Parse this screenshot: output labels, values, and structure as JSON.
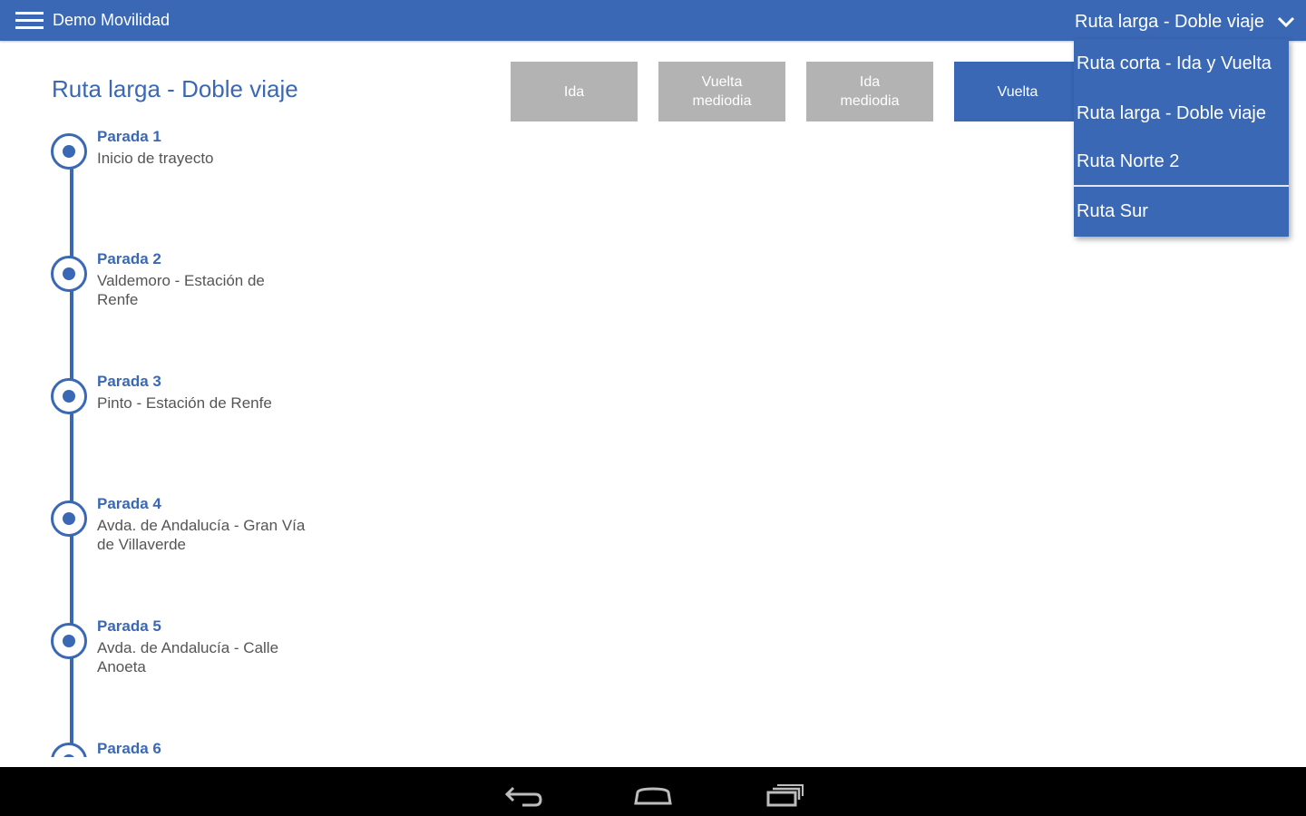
{
  "topbar": {
    "app_title": "Demo Movilidad",
    "selected_route": "Ruta larga - Doble viaje"
  },
  "page": {
    "route_title": "Ruta larga - Doble viaje"
  },
  "tabs": [
    {
      "label": "Ida",
      "active": false
    },
    {
      "label": "Vuelta mediodia",
      "active": false
    },
    {
      "label": "Ida mediodia",
      "active": false
    },
    {
      "label": "Vuelta",
      "active": true
    }
  ],
  "stops": [
    {
      "name": "Parada 1",
      "description": "Inicio de trayecto"
    },
    {
      "name": "Parada 2",
      "description": "Valdemoro - Estación de Renfe"
    },
    {
      "name": "Parada 3",
      "description": "Pinto - Estación de Renfe"
    },
    {
      "name": "Parada 4",
      "description": "Avda. de Andalucía - Gran Vía de Villaverde"
    },
    {
      "name": "Parada 5",
      "description": "Avda. de Andalucía - Calle Anoeta"
    },
    {
      "name": "Parada 6",
      "description": ""
    }
  ],
  "dropdown": {
    "items": [
      {
        "label": "Ruta corta - Ida y Vuelta"
      },
      {
        "label": "Ruta larga - Doble viaje"
      },
      {
        "label": "Ruta Norte 2"
      },
      {
        "label": "Ruta Sur"
      }
    ]
  },
  "navbar": {
    "buttons": [
      "back-icon",
      "home-icon",
      "recent-apps-icon"
    ]
  },
  "colors": {
    "primary": "#3a68b5",
    "inactive_tab": "#b3b3b3",
    "navbar": "#000000"
  }
}
